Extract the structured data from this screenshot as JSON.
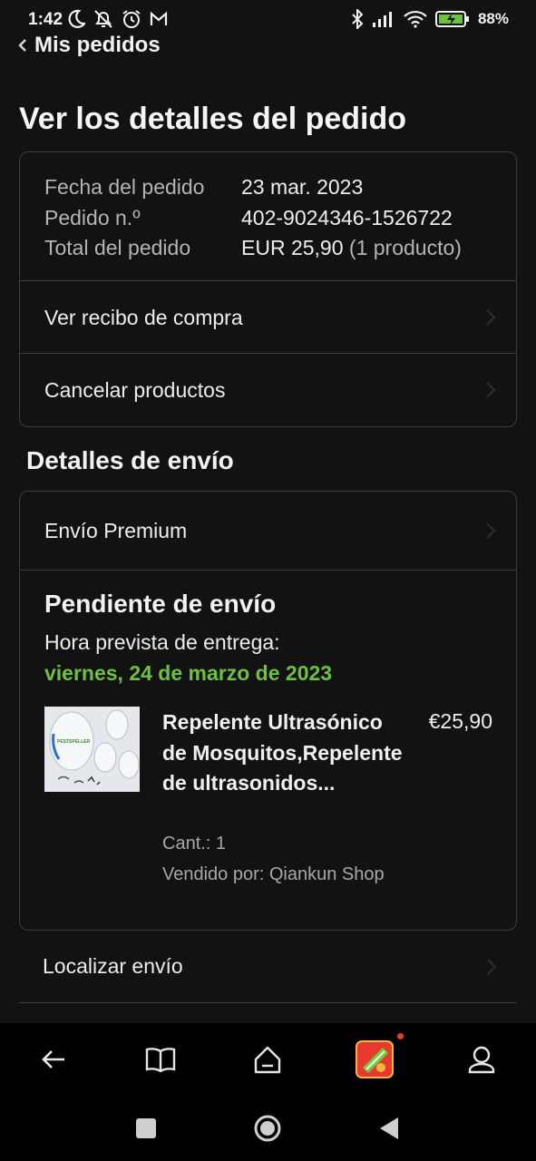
{
  "status_bar": {
    "time": "1:42",
    "battery": "88%",
    "icons_left": [
      "moon-icon",
      "bell-off-icon",
      "alarm-icon",
      "gmail-icon"
    ],
    "icons_right": [
      "bluetooth-icon",
      "signal-icon",
      "wifi-icon",
      "battery-icon"
    ],
    "battery_level": 0.88
  },
  "header": {
    "back_label": "Mis pedidos",
    "title": "Ver los detalles del pedido"
  },
  "order_summary": {
    "rows": [
      {
        "label": "Fecha del pedido",
        "value": "23 mar. 2023",
        "extra": ""
      },
      {
        "label": "Pedido n.º",
        "value": "402-9024346-1526722",
        "extra": ""
      },
      {
        "label": "Total del pedido",
        "value": "EUR 25,90",
        "extra": " (1 producto)"
      }
    ],
    "links": [
      "Ver recibo de compra",
      "Cancelar productos"
    ]
  },
  "shipping": {
    "section_title": "Detalles de envío",
    "method": "Envío Premium",
    "status": "Pendiente de envío",
    "eta_label": "Hora prevista de entrega:",
    "eta_date": "viernes, 24 de marzo de 2023",
    "eta_color": "#6cc23f",
    "product": {
      "title": "Repelente Ultrasónico de Mosquitos,Repelente de ultrasonidos...",
      "price": "€25,90",
      "quantity": "Cant.: 1",
      "seller": "Vendido por: Qiankun Shop",
      "image_brand": "PESTSPELLER"
    },
    "track_label": "Localizar envío"
  },
  "bottom_nav": {
    "items": [
      "back-arrow-icon",
      "book-icon",
      "home-icon",
      "game-app-icon",
      "profile-icon"
    ]
  },
  "system_nav": {
    "items": [
      "recents-square-icon",
      "home-circle-icon",
      "back-triangle-icon"
    ]
  }
}
